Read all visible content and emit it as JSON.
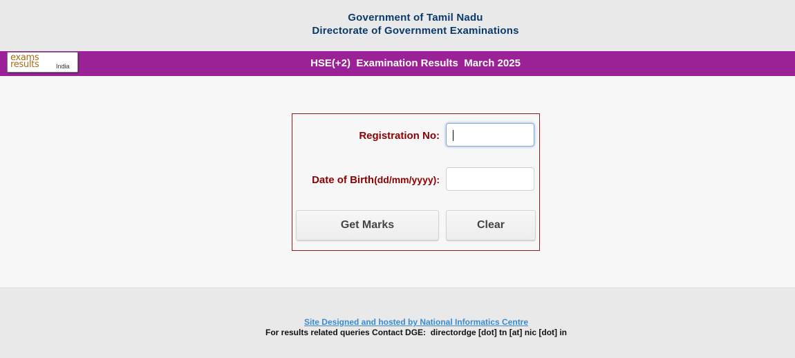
{
  "header": {
    "line1": "Government of Tamil Nadu",
    "line2": "Directorate of Government Examinations"
  },
  "banner": {
    "logo": {
      "word1": "exams",
      "word2": "results",
      "word3": "India"
    },
    "title": "HSE(+2)  Examination Results  March 2025",
    "color": "#9b2196"
  },
  "form": {
    "registration_label": "Registration No:",
    "registration_value": "",
    "dob_label_main": "Date of Birth",
    "dob_label_format": "(dd/mm/yyyy):",
    "dob_value": "",
    "get_marks_label": "Get Marks",
    "clear_label": "Clear",
    "label_color": "#8b0000"
  },
  "footer": {
    "link_text": "Site Designed and hosted by National Informatics Centre",
    "contact_text": "For results related queries Contact DGE:  directordge [dot] tn [at] nic [dot] in"
  }
}
